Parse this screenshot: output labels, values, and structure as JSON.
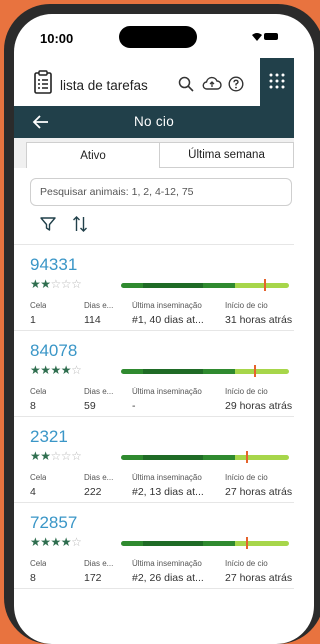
{
  "status": {
    "time": "10:00"
  },
  "header": {
    "title": "lista de tarefas"
  },
  "nav": {
    "title": "No cio"
  },
  "tabs": [
    {
      "label": "Ativo"
    },
    {
      "label": "Última semana"
    }
  ],
  "search": {
    "placeholder": "Pesquisar animais: 1, 2, 4-12, 75"
  },
  "columns": {
    "cela": "Cela",
    "dias": "Dias e...",
    "ultima": "Última inseminação",
    "inicio": "Início de cio"
  },
  "colors": {
    "header": "#21404a",
    "id": "#3a96c7",
    "star": "#2f6e4f",
    "marker": "#e5632c",
    "bar_dark": "#2f8a2f",
    "bar_mid": "#1f6b26",
    "bar_light": "#a7d64a"
  },
  "animals": [
    {
      "id": "94331",
      "rating": 2,
      "cela": "1",
      "dias": "114",
      "ultima": "#1, 40 dias at...",
      "inicio": "31 horas atrás",
      "marker_fraction": 0.86
    },
    {
      "id": "84078",
      "rating": 4,
      "cela": "8",
      "dias": "59",
      "ultima": "-",
      "inicio": "29 horas atrás",
      "marker_fraction": 0.8
    },
    {
      "id": "2321",
      "rating": 2,
      "cela": "4",
      "dias": "222",
      "ultima": "#2, 13 dias at...",
      "inicio": "27 horas atrás",
      "marker_fraction": 0.75
    },
    {
      "id": "72857",
      "rating": 4,
      "cela": "8",
      "dias": "172",
      "ultima": "#2, 26 dias at...",
      "inicio": "27 horas atrás",
      "marker_fraction": 0.75
    }
  ]
}
